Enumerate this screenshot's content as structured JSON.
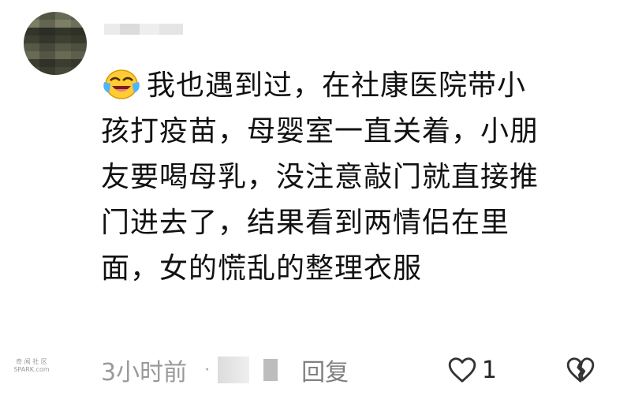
{
  "comment": {
    "lines": [
      "我也遇到过，在社康医院带小",
      "孩打疫苗，母婴室一直关着，小朋",
      "友要喝母乳，没注意敲门就直接推",
      "门进去了，结果看到两情侣在里",
      "面，女的慌乱的整理衣服"
    ],
    "emoji": "laughing-crying-emoji"
  },
  "meta": {
    "time": "3小时前",
    "dot": "·",
    "reply_label": "回复",
    "like_count": "1"
  },
  "watermark": {
    "line1": "奇 闻 社 区",
    "line2": "SPARK.com"
  },
  "icons": {
    "like": "heart-icon",
    "dislike": "broken-heart-icon"
  },
  "colors": {
    "text": "#111111",
    "meta": "#9a9a9a"
  }
}
